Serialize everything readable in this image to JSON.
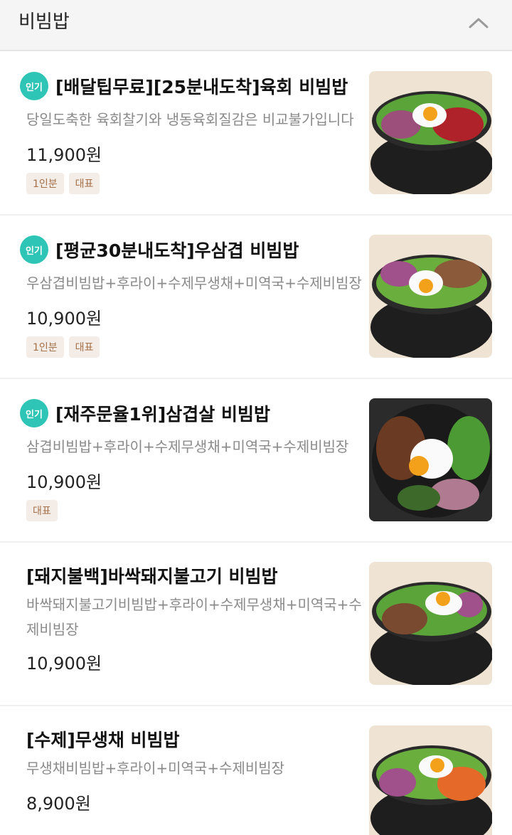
{
  "header": {
    "title": "비빔밥"
  },
  "items": [
    {
      "badge": "인기",
      "title": "[배달팁무료][25분내도착]육회 비빔밥",
      "desc": "당일도축한 육회찰기와 냉동육회질감은 비교불가입니다",
      "price": "11,900원",
      "tags": [
        "1인분",
        "대표"
      ]
    },
    {
      "badge": "인기",
      "title": "[평균30분내도착]우삼겹 비빔밥",
      "desc": "우삼겹비빔밥+후라이+수제무생채+미역국+수제비빔장",
      "price": "10,900원",
      "tags": [
        "1인분",
        "대표"
      ]
    },
    {
      "badge": "인기",
      "title": "[재주문율1위]삼겹살 비빔밥",
      "desc": "삼겹비빔밥+후라이+수제무생채+미역국+수제비빔장",
      "price": "10,900원",
      "tags": [
        "대표"
      ]
    },
    {
      "title": "[돼지불백]바싹돼지불고기 비빔밥",
      "desc": "바싹돼지불고기비빔밥+후라이+수제무생채+미역국+수제비빔장",
      "price": "10,900원"
    },
    {
      "title": "[수제]무생채 비빔밥",
      "desc": "무생채비빔밥+후라이+미역국+수제비빔장",
      "price": "8,900원"
    }
  ],
  "icons": {
    "collapse": "chevron-up-icon",
    "badge_color": "#2ec4b6"
  }
}
